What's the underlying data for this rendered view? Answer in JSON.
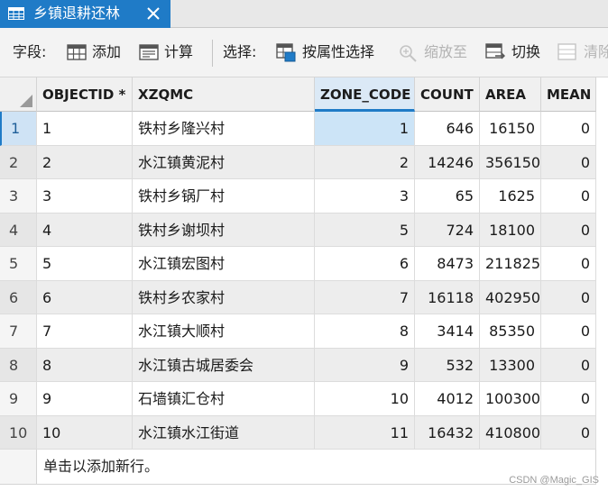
{
  "tab": {
    "title": "乡镇退耕还林",
    "icon": "table-icon",
    "close_icon": "close-icon",
    "colors": {
      "active_bg": "#1f7bc7",
      "text": "#ffffff"
    }
  },
  "toolbar": {
    "field_label": "字段:",
    "add_label": "添加",
    "calc_label": "计算",
    "select_label": "选择:",
    "select_by_attr_label": "按属性选择",
    "zoom_to_label": "缩放至",
    "switch_label": "切换",
    "clear_label": "清除"
  },
  "table": {
    "columns": [
      "OBJECTID *",
      "XZQMC",
      "ZONE_CODE",
      "COUNT",
      "AREA",
      "MEAN"
    ],
    "selected_column": "ZONE_CODE",
    "rows": [
      {
        "row": "1",
        "objectid": "1",
        "xzqmc": "铁村乡隆兴村",
        "zone_code": "1",
        "count": "646",
        "area": "16150",
        "mean": "0"
      },
      {
        "row": "2",
        "objectid": "2",
        "xzqmc": "水江镇黄泥村",
        "zone_code": "2",
        "count": "14246",
        "area": "356150",
        "mean": "0"
      },
      {
        "row": "3",
        "objectid": "3",
        "xzqmc": "铁村乡锅厂村",
        "zone_code": "3",
        "count": "65",
        "area": "1625",
        "mean": "0"
      },
      {
        "row": "4",
        "objectid": "4",
        "xzqmc": "铁村乡谢坝村",
        "zone_code": "5",
        "count": "724",
        "area": "18100",
        "mean": "0"
      },
      {
        "row": "5",
        "objectid": "5",
        "xzqmc": "水江镇宏图村",
        "zone_code": "6",
        "count": "8473",
        "area": "211825",
        "mean": "0"
      },
      {
        "row": "6",
        "objectid": "6",
        "xzqmc": "铁村乡农家村",
        "zone_code": "7",
        "count": "16118",
        "area": "402950",
        "mean": "0"
      },
      {
        "row": "7",
        "objectid": "7",
        "xzqmc": "水江镇大顺村",
        "zone_code": "8",
        "count": "3414",
        "area": "85350",
        "mean": "0"
      },
      {
        "row": "8",
        "objectid": "8",
        "xzqmc": "水江镇古城居委会",
        "zone_code": "9",
        "count": "532",
        "area": "13300",
        "mean": "0"
      },
      {
        "row": "9",
        "objectid": "9",
        "xzqmc": "石墙镇汇仓村",
        "zone_code": "10",
        "count": "4012",
        "area": "100300",
        "mean": "0"
      },
      {
        "row": "10",
        "objectid": "10",
        "xzqmc": "水江镇水江街道",
        "zone_code": "11",
        "count": "16432",
        "area": "410800",
        "mean": "0"
      }
    ],
    "new_row_text": "单击以添加新行。"
  },
  "watermark": "CSDN @Magic_GIS"
}
